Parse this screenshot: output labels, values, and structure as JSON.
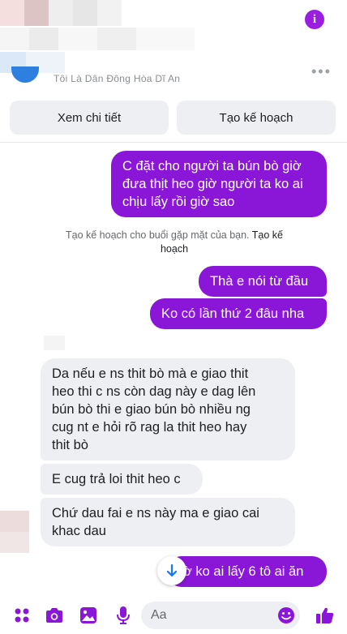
{
  "header": {
    "subtitle": "Tôi Là Dân Đông Hòa Dĩ An",
    "more_glyph": "•••"
  },
  "actions": {
    "details_label": "Xem chi tiết",
    "plan_label": "Tạo kế hoạch"
  },
  "messages": {
    "m1": {
      "sender": "me",
      "line1": "C đặt cho người ta bún bò giờ",
      "line2": "đưa thịt heo giờ người ta ko ai",
      "line3": "chịu lấy rồi giờ sao"
    },
    "hint": {
      "text": "Tạo kế hoạch cho buổi gặp mặt của bạn.",
      "link_line1": "Tạo kế",
      "link_line2": "hoạch"
    },
    "m2": {
      "sender": "me",
      "text": "Thà e nói từ đầu"
    },
    "m3": {
      "sender": "me",
      "text": "Ko có lần thứ 2 đâu nha"
    },
    "m4": {
      "sender": "other",
      "line1": "Da nếu e ns thit bò mà e giao thit",
      "line2": "heo thi c ns còn dag này e dag lên",
      "line3": "bún bò thi e giao bún bò nhiều ng",
      "line4": "cug nt e hỏi rõ rag la thit heo hay",
      "line5": "thit bò"
    },
    "m5": {
      "sender": "other",
      "text": "E cug trả loi thit heo c"
    },
    "m6": {
      "sender": "other",
      "line1": "Chứ dau fai e ns này ma e giao cai",
      "line2": "khac dau"
    },
    "m7": {
      "sender": "me",
      "text": "ờ ko ai lấy 6 tô ai ăn"
    }
  },
  "composer": {
    "placeholder": "Aa"
  },
  "icons": {
    "info": "info-icon",
    "menu": "apps-grid-icon",
    "camera": "camera-icon",
    "gallery": "image-icon",
    "mic": "microphone-icon",
    "emoji": "emoji-icon",
    "like": "thumbs-up-icon",
    "scroll": "arrow-down-icon"
  },
  "colors": {
    "accent": "#8a16d8",
    "blue": "#1877f2",
    "incoming": "#eeeff2"
  }
}
